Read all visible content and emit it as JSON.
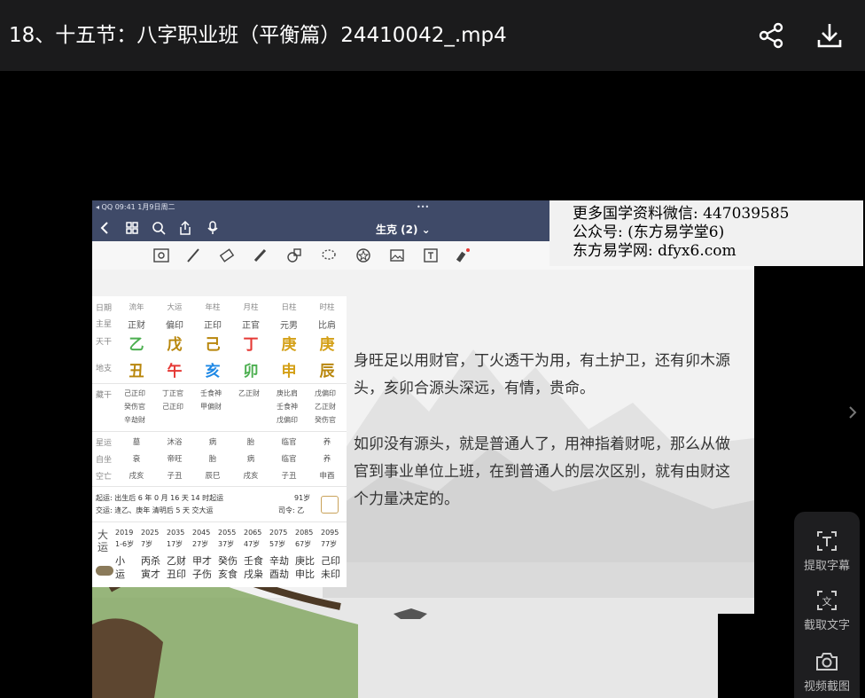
{
  "header": {
    "title": "18、十五节：八字职业班（平衡篇）24410042_.mp4",
    "share_icon": "share-icon",
    "download_icon": "download-icon"
  },
  "ipad": {
    "status_left": "◂ QQ   09:41   1月9日周二",
    "status_center": "•••",
    "doc_title": "生克 (2) ⌄"
  },
  "watermark": {
    "line1": "更多国学资料微信: 447039585",
    "line2": "公众号: (东方易学堂6)",
    "line3": "东方易学网: dfyx6.com"
  },
  "bazi": {
    "row_labels": [
      "日期",
      "主星",
      "天干",
      "地支",
      "藏干",
      "星运",
      "自坐",
      "空亡"
    ],
    "columns": [
      "流年",
      "大运",
      "年柱",
      "月柱",
      "日柱",
      "时柱"
    ],
    "zhuxing": [
      "正财",
      "偏印",
      "正印",
      "正官",
      "元男",
      "比肩"
    ],
    "tiangan": [
      "乙",
      "戊",
      "己",
      "丁",
      "庚",
      "庚"
    ],
    "tiangan_colors": [
      "#4caf50",
      "#b8860b",
      "#b8860b",
      "#e53935",
      "#d4a017",
      "#d4a017"
    ],
    "dizhi": [
      "丑",
      "午",
      "亥",
      "卯",
      "申",
      "辰"
    ],
    "dizhi_colors": [
      "#b8860b",
      "#e53935",
      "#1e88e5",
      "#4caf50",
      "#d4a017",
      "#b8860b"
    ],
    "canggan": [
      [
        "己正印",
        "癸伤官",
        "辛劫财"
      ],
      [
        "丁正官",
        "己正印",
        ""
      ],
      [
        "壬食神",
        "甲偏财",
        ""
      ],
      [
        "乙正财",
        "",
        ""
      ],
      [
        "庚比肩",
        "壬食神",
        "戊偏印"
      ],
      [
        "戊偏印",
        "乙正财",
        "癸伤官"
      ]
    ],
    "xingyun": [
      "墓",
      "沐浴",
      "病",
      "胎",
      "临官",
      "养"
    ],
    "zizuo": [
      "衰",
      "帝旺",
      "胎",
      "病",
      "临官",
      "养"
    ],
    "kongwang": [
      "戌亥",
      "子丑",
      "辰巳",
      "戌亥",
      "子丑",
      "申酉"
    ],
    "qiyun": "起运: 出生后 6 年 0 月 16 天 14 时起运",
    "age": "91岁",
    "jiaoyun": "交运: 逢乙、庚年 清明后 5 天 交大运",
    "siling": "司令: 乙",
    "dayun_label": "大运",
    "dayun_years": [
      "2019",
      "2025",
      "2035",
      "2045",
      "2055",
      "2065",
      "2075",
      "2085",
      "2095"
    ],
    "dayun_ages": [
      "1-6岁",
      "7岁",
      "17岁",
      "27岁",
      "37岁",
      "47岁",
      "57岁",
      "67岁",
      "77岁"
    ],
    "dayun_top": [
      "小",
      "丙杀",
      "乙财",
      "甲才",
      "癸伤",
      "壬食",
      "辛劫",
      "庚比",
      "己印"
    ],
    "dayun_bottom": [
      "运",
      "寅才",
      "丑印",
      "子伤",
      "亥食",
      "戌枭",
      "酉劫",
      "申比",
      "未印"
    ]
  },
  "text": {
    "p1": "身旺足以用财官，丁火透干为用，有土护卫，还有卯木源头，亥卯合源头深远，有情，贵命。",
    "p2": "如卯没有源头，就是普通人了，用神指着财呢，那么从做官到事业单位上班，在到普通人的层次区别，就有由财这个力量决定的。"
  },
  "side": {
    "btn1": "提取字幕",
    "btn2": "截取文字",
    "btn3": "视频截图"
  }
}
